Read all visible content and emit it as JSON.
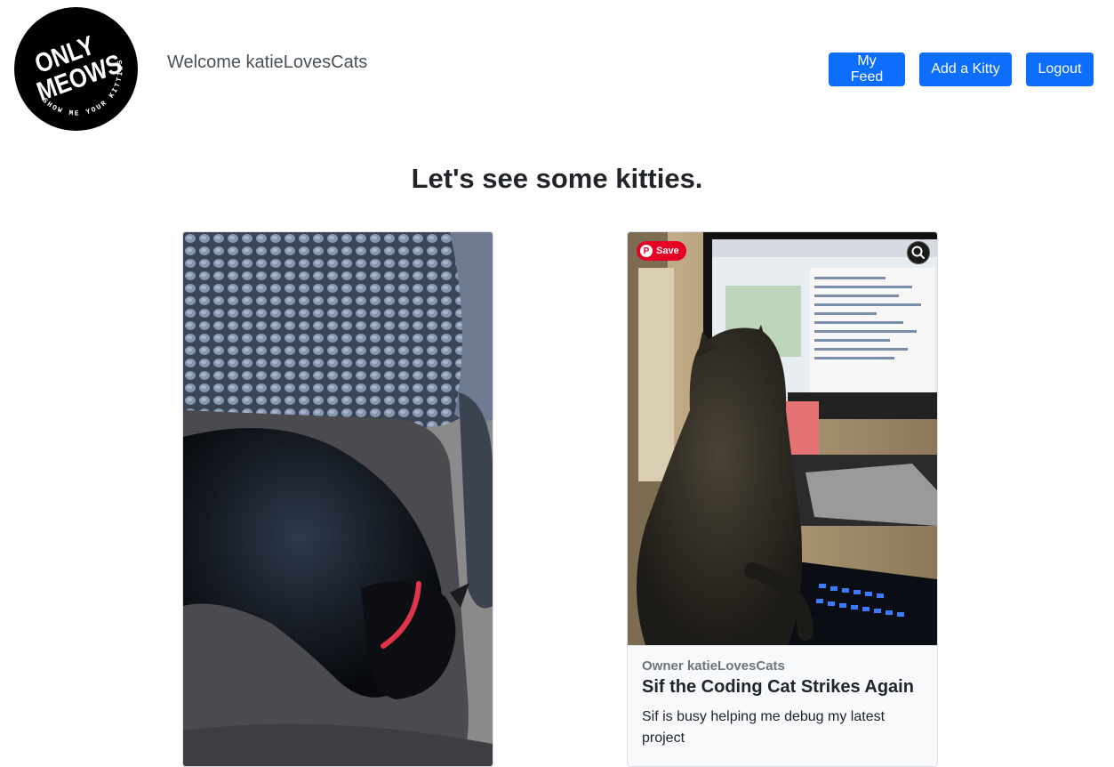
{
  "header": {
    "logo_line1": "ONLY",
    "logo_line2": "MEOWS",
    "logo_ring_text": "SHOW ME YOUR KITTIES",
    "welcome": "Welcome katieLovesCats",
    "nav": {
      "feed_label": "My Feed",
      "add_label": "Add a Kitty",
      "logout_label": "Logout"
    }
  },
  "main": {
    "heading": "Let's see some kitties."
  },
  "cards": [
    {
      "image_alt": "black cat sleeping on office chair"
    },
    {
      "save_label": "Save",
      "owner": "Owner katieLovesCats",
      "title": "Sif the Coding Cat Strikes Again",
      "description": "Sif is busy helping me debug my latest project"
    }
  ],
  "colors": {
    "primary": "#0d6efd",
    "pinterest": "#e60023"
  }
}
